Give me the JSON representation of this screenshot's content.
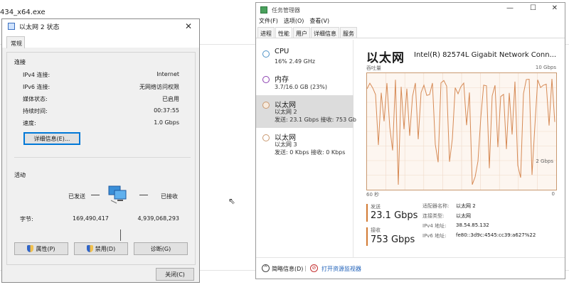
{
  "background": {
    "title": "434_x64.exe"
  },
  "status_dialog": {
    "title": "以太网 2 状态",
    "tab": "常规",
    "connection_group": "连接",
    "fields": [
      {
        "label": "IPv4 连接:",
        "value": "Internet"
      },
      {
        "label": "IPv6 连接:",
        "value": "无网络访问权限"
      },
      {
        "label": "媒体状态:",
        "value": "已启用"
      },
      {
        "label": "持续时间:",
        "value": "00:37:55"
      },
      {
        "label": "速度:",
        "value": "1.0 Gbps"
      }
    ],
    "details_button": "详细信息(E)...",
    "activity_group": "活动",
    "sent_label": "已发送",
    "received_label": "已接收",
    "bytes_label": "字节:",
    "bytes_sent": "169,490,417",
    "bytes_received": "4,939,068,293",
    "buttons": {
      "properties": "属性(P)",
      "disable": "禁用(D)",
      "diagnose": "诊断(G)",
      "close": "关闭(C)"
    }
  },
  "task_manager": {
    "title": "任务管理器",
    "menu": [
      "文件(F)",
      "选项(O)",
      "查看(V)"
    ],
    "tabs": [
      "进程",
      "性能",
      "用户",
      "详细信息",
      "服务"
    ],
    "active_tab": "性能",
    "resources": [
      {
        "name": "CPU",
        "sub1": "16% 2.49 GHz",
        "sub2": ""
      },
      {
        "name": "内存",
        "sub1": "3.7/16.0 GB (23%)",
        "sub2": ""
      },
      {
        "name": "以太网",
        "sub1": "以太网 2",
        "sub2": "发送: 23.1 Gbps 接收: 753 Gb"
      },
      {
        "name": "以太网",
        "sub1": "以太网 3",
        "sub2": "发送: 0 Kbps 接收: 0 Kbps"
      }
    ],
    "panel": {
      "title": "以太网",
      "adapter": "Intel(R) 82574L Gigabit Network Conn...",
      "throughput_label": "吞吐量",
      "max_label": "10 Gbps",
      "mid_label": "2 Gbps",
      "time_left": "60 秒",
      "time_right": "0",
      "send_label": "发送",
      "send_value": "23.1 Gbps",
      "recv_label": "接收",
      "recv_value": "753 Gbps",
      "details": [
        {
          "label": "适配器名称:",
          "value": "以太网 2"
        },
        {
          "label": "连接类型:",
          "value": "以太网"
        },
        {
          "label": "IPv4 地址:",
          "value": "38.54.85.132"
        },
        {
          "label": "IPv6 地址:",
          "value": "fe80::3d9c:4545:cc39:a627%22"
        }
      ]
    },
    "footer": {
      "brief": "简略信息(D)",
      "monitor": "打开资源监视器"
    },
    "colors": {
      "graph_line": "#d68a55",
      "graph_border": "#c9986f",
      "accent": "#d27a33"
    }
  }
}
